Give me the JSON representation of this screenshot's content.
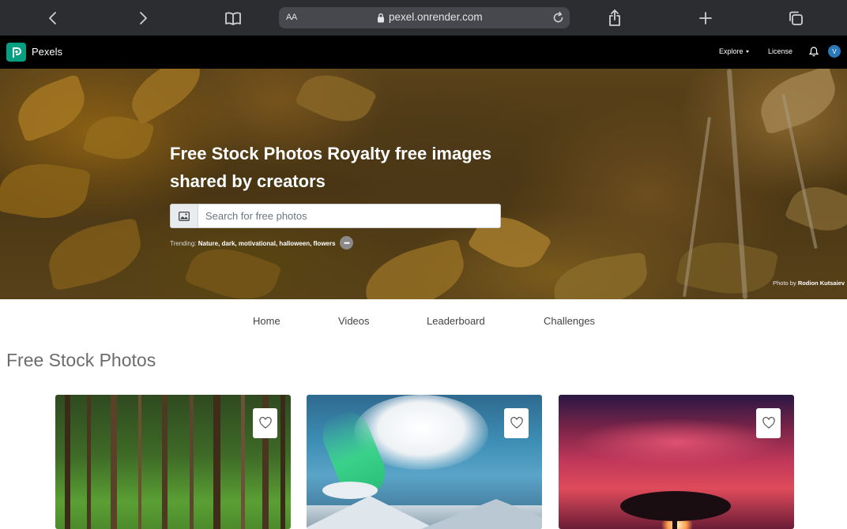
{
  "browser": {
    "text_size_label": "AA",
    "url": "pexel.onrender.com"
  },
  "header": {
    "brand": "Pexels",
    "explore": "Explore",
    "license": "License",
    "avatar_initial": "V"
  },
  "hero": {
    "title": "Free Stock Photos Royalty free images shared by creators",
    "search_placeholder": "Search for free photos",
    "trending_label": "Trending:",
    "trending_items": "Nature, dark, motivational, halloween, flowers",
    "more_label": "•••",
    "credit_prefix": "Photo by",
    "credit_author": "Rodion Kutsaiev"
  },
  "tabs": [
    "Home",
    "Videos",
    "Leaderboard",
    "Challenges"
  ],
  "section_title": "Free Stock Photos",
  "cards": [
    {
      "icon": "heart-icon"
    },
    {
      "icon": "heart-icon"
    },
    {
      "icon": "heart-icon"
    }
  ],
  "colors": {
    "brand": "#05a081",
    "header_bg": "#000000",
    "browser_bar": "#2b2d31",
    "avatar": "#2a79b8"
  }
}
